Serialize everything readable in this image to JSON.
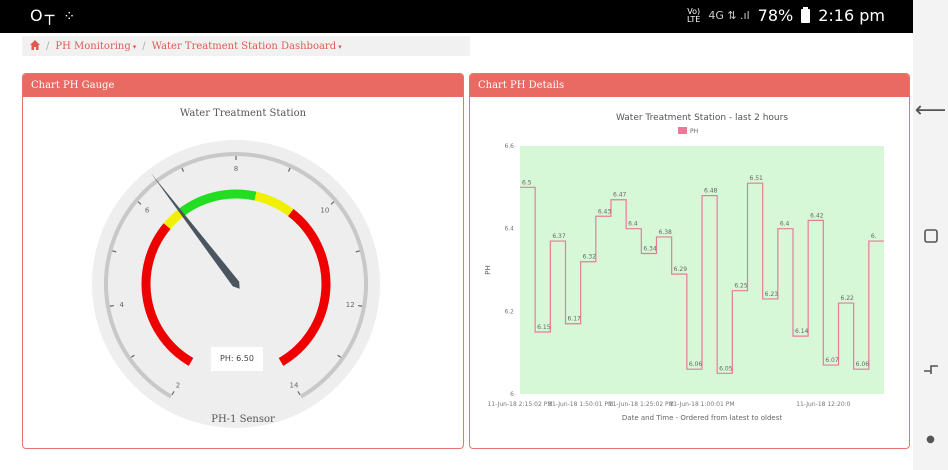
{
  "status_bar": {
    "left_icons": [
      "key-icon",
      "dots-icon"
    ],
    "volte": "Vo)",
    "lte": "LTE",
    "signal": "4G ⇅ .ıl",
    "battery": "78%",
    "time": "2:16 pm"
  },
  "breadcrumb": {
    "items": [
      {
        "label": "PH Monitoring"
      },
      {
        "label": "Water Treatment Station Dashboard"
      }
    ]
  },
  "gauge_panel": {
    "header": "Chart PH Gauge",
    "title": "Water Treatment Station",
    "readout": "PH: 6.50",
    "sensor": "PH-1 Sensor",
    "value": 6.5,
    "min": 2,
    "max": 14,
    "tick_labels": [
      "2",
      "4",
      "6",
      "8",
      "10",
      "12",
      "14"
    ],
    "bands": [
      {
        "from": 2,
        "to": 6,
        "color": "#ee0000"
      },
      {
        "from": 6,
        "to": 6.5,
        "color": "#f0f000"
      },
      {
        "from": 6.5,
        "to": 8.5,
        "color": "#22dd22"
      },
      {
        "from": 8.5,
        "to": 9.5,
        "color": "#f0f000"
      },
      {
        "from": 9.5,
        "to": 14,
        "color": "#ee0000"
      }
    ]
  },
  "details_panel": {
    "header": "Chart PH Details"
  },
  "chart_data": {
    "type": "line",
    "step": true,
    "title": "Water Treatment Station - last 2 hours",
    "xlabel": "Date and Time - Ordered from latest to oldest",
    "ylabel": "PH",
    "ylim": [
      6,
      6.6
    ],
    "yticks": [
      "6",
      "6.2",
      "6.4",
      "6.6"
    ],
    "legend": "top-center",
    "series": [
      {
        "name": "PH",
        "color": "#e87a9a",
        "values": [
          6.5,
          6.15,
          6.37,
          6.17,
          6.32,
          6.43,
          6.47,
          6.4,
          6.34,
          6.38,
          6.29,
          6.06,
          6.48,
          6.05,
          6.25,
          6.51,
          6.23,
          6.4,
          6.14,
          6.42,
          6.07,
          6.22,
          6.06,
          6.37
        ],
        "labels": [
          "6.5",
          "6.15",
          "6.37",
          "6.17",
          "6.32",
          "6.43",
          "6.47",
          "6.4",
          "6.34",
          "6.38",
          "6.29",
          "6.06",
          "6.48",
          "6.05",
          "6.25",
          "6.51",
          "6.23",
          "6.4",
          "6.14",
          "6.42",
          "6.07",
          "6.22",
          "6.06",
          "6."
        ]
      }
    ],
    "x_tick_labels": [
      "11-Jun-18 2:15:02 PM",
      "11-Jun-18 1:50:01 PM",
      "11-Jun-18 1:25:02 PM",
      "11-Jun-18 1:00:01 PM",
      "11-Jun-18 12:20:0"
    ],
    "x_tick_positions": [
      0,
      4,
      8,
      12,
      20
    ],
    "plot_background": "#d6f8d6"
  }
}
